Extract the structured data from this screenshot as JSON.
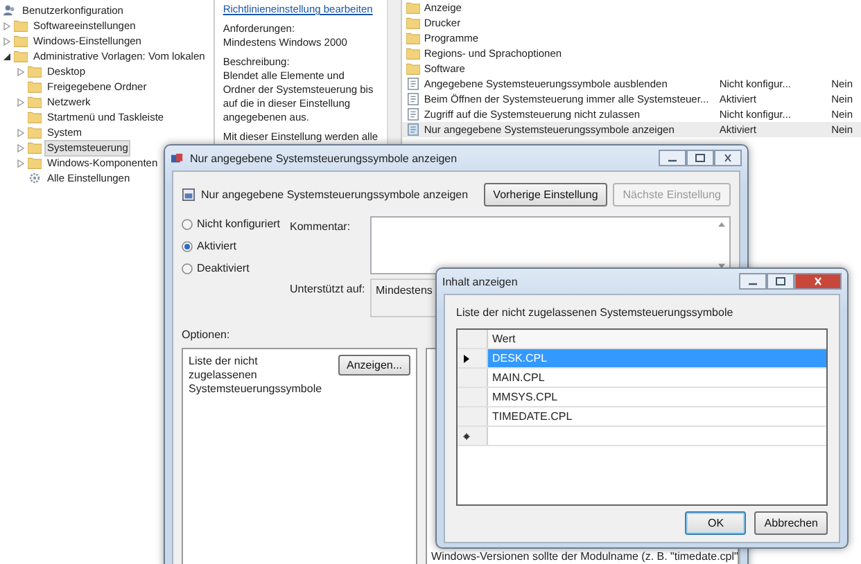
{
  "tree": {
    "items": [
      {
        "label": "Benutzerkonfiguration",
        "kind": "user",
        "selected": false,
        "children": [
          {
            "label": "Softwareeinstellungen",
            "kind": "folder",
            "expanded": false,
            "selected": false
          },
          {
            "label": "Windows-Einstellungen",
            "kind": "folder",
            "expanded": false,
            "selected": false
          },
          {
            "label": "Administrative Vorlagen: Vom lokalen",
            "kind": "folder",
            "expanded": true,
            "selected": false,
            "children": [
              {
                "label": "Desktop",
                "kind": "folder",
                "expanded": false,
                "selected": false
              },
              {
                "label": "Freigegebene Ordner",
                "kind": "folder",
                "selected": false
              },
              {
                "label": "Netzwerk",
                "kind": "folder",
                "expanded": false,
                "selected": false
              },
              {
                "label": "Startmenü und Taskleiste",
                "kind": "folder",
                "selected": false
              },
              {
                "label": "System",
                "kind": "folder",
                "expanded": false,
                "selected": false
              },
              {
                "label": "Systemsteuerung",
                "kind": "folder",
                "expanded": false,
                "selected": true
              },
              {
                "label": "Windows-Komponenten",
                "kind": "folder",
                "expanded": false,
                "selected": false
              },
              {
                "label": "Alle Einstellungen",
                "kind": "all",
                "selected": false
              }
            ]
          }
        ]
      }
    ]
  },
  "details": {
    "link": "Richtlinieneinstellung bearbeiten",
    "requirements_label": "Anforderungen:",
    "requirements": "Mindestens Windows 2000",
    "description_label": "Beschreibung:",
    "description": "Blendet alle Elemente und Ordner der Systemsteuerung bis auf die in dieser Einstellung angegebenen aus.",
    "description_more": "Mit dieser Einstellung werden alle"
  },
  "list": {
    "folders": [
      "Anzeige",
      "Drucker",
      "Programme",
      "Regions- und Sprachoptionen",
      "Software"
    ],
    "policies": [
      {
        "name": "Angegebene Systemsteuerungssymbole ausblenden",
        "state": "Nicht konfigur...",
        "comment": "Nein",
        "selected": false
      },
      {
        "name": "Beim Öffnen der Systemsteuerung immer alle Systemsteuer...",
        "state": "Aktiviert",
        "comment": "Nein",
        "selected": false
      },
      {
        "name": "Zugriff auf die Systemsteuerung nicht zulassen",
        "state": "Nicht konfigur...",
        "comment": "Nein",
        "selected": false
      },
      {
        "name": "Nur angegebene Systemsteuerungssymbole anzeigen",
        "state": "Aktiviert",
        "comment": "Nein",
        "selected": true
      }
    ]
  },
  "policy_dialog": {
    "title": "Nur angegebene Systemsteuerungssymbole anzeigen",
    "header": "Nur angegebene Systemsteuerungssymbole anzeigen",
    "buttons": [
      {
        "label": "Vorherige Einstellung",
        "disabled": false
      },
      {
        "label": "Nächste Einstellung",
        "disabled": true
      }
    ],
    "radios": [
      {
        "label": "Nicht konfiguriert",
        "selected": false
      },
      {
        "label": "Aktiviert",
        "selected": true
      },
      {
        "label": "Deaktiviert",
        "selected": false
      }
    ],
    "comment_label": "Kommentar:",
    "supported_label": "Unterstützt auf:",
    "supported_value": "Mindestens",
    "options_label": "Optionen:",
    "option": {
      "label": "Liste der nicht zugelassenen Systemsteuerungssymbole",
      "button": "Anzeigen..."
    },
    "help_text": "Windows-Versionen sollte der Modulname (z. B. \"timedate.cpl\""
  },
  "content_dialog": {
    "title": "Inhalt anzeigen",
    "label": "Liste der nicht zugelassenen Systemsteuerungssymbole",
    "column": "Wert",
    "rows": [
      {
        "value": "DESK.CPL",
        "selected": true
      },
      {
        "value": "MAIN.CPL",
        "selected": false
      },
      {
        "value": "MMSYS.CPL",
        "selected": false
      },
      {
        "value": "TIMEDATE.CPL",
        "selected": false
      }
    ],
    "buttons": [
      {
        "label": "OK",
        "default": true
      },
      {
        "label": "Abbrechen",
        "default": false
      }
    ]
  }
}
